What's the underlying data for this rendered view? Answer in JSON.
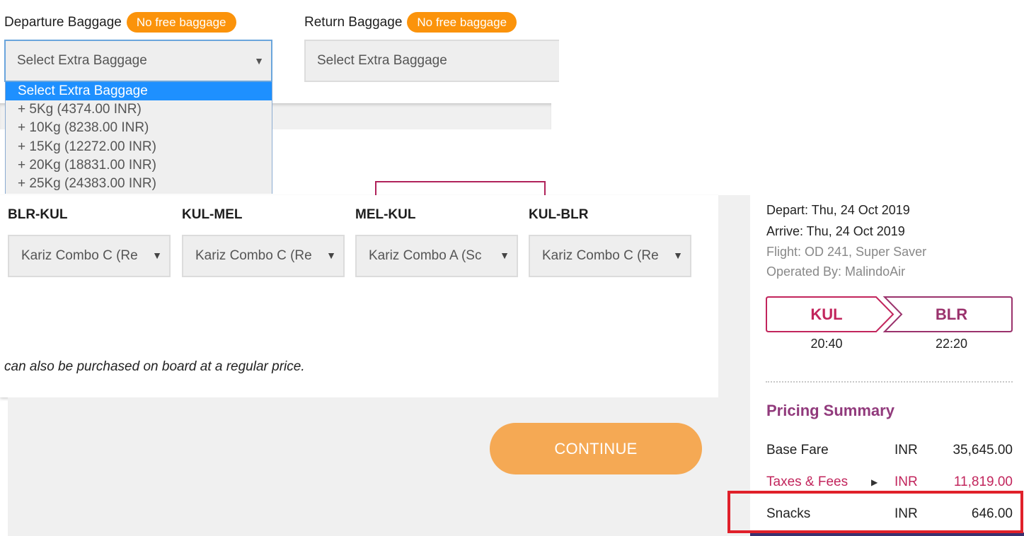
{
  "baggage": {
    "departure": {
      "label": "Departure Baggage",
      "badge": "No free baggage",
      "selected": "Select Extra Baggage",
      "options": [
        "Select Extra Baggage",
        "+ 5Kg (4374.00 INR)",
        "+ 10Kg (8238.00 INR)",
        "+ 15Kg (12272.00 INR)",
        "+ 20Kg (18831.00 INR)",
        "+ 25Kg (24383.00 INR)"
      ]
    },
    "return": {
      "label": "Return Baggage",
      "badge": "No free baggage",
      "selected": "Select Extra Baggage"
    }
  },
  "snacks": {
    "legs": [
      {
        "route": "BLR-KUL",
        "selected": "Kariz Combo C (Re"
      },
      {
        "route": "KUL-MEL",
        "selected": "Kariz Combo C (Re"
      },
      {
        "route": "MEL-KUL",
        "selected": "Kariz Combo A (Sc"
      },
      {
        "route": "KUL-BLR",
        "selected": "Kariz Combo C (Re"
      }
    ],
    "note": "can also be purchased on board at a regular price."
  },
  "continue_label": "CONTINUE",
  "flight": {
    "depart": "Depart: Thu, 24 Oct 2019",
    "arrive": "Arrive: Thu, 24 Oct 2019",
    "flight_info": "Flight: OD 241, Super Saver",
    "operated_by": "Operated By: MalindoAir",
    "origin": "KUL",
    "destination": "BLR",
    "depart_time": "20:40",
    "arrive_time": "22:20"
  },
  "pricing": {
    "title": "Pricing Summary",
    "rows": [
      {
        "label": "Base Fare",
        "currency": "INR",
        "amount": "35,645.00"
      },
      {
        "label": "Taxes & Fees",
        "currency": "INR",
        "amount": "11,819.00"
      },
      {
        "label": "Snacks",
        "currency": "INR",
        "amount": "646.00"
      }
    ]
  },
  "colors": {
    "badge": "#fb930b",
    "accent": "#b0225a",
    "pricing_title": "#913a7c",
    "continue": "#f5a954",
    "highlight": "#e0202a"
  }
}
